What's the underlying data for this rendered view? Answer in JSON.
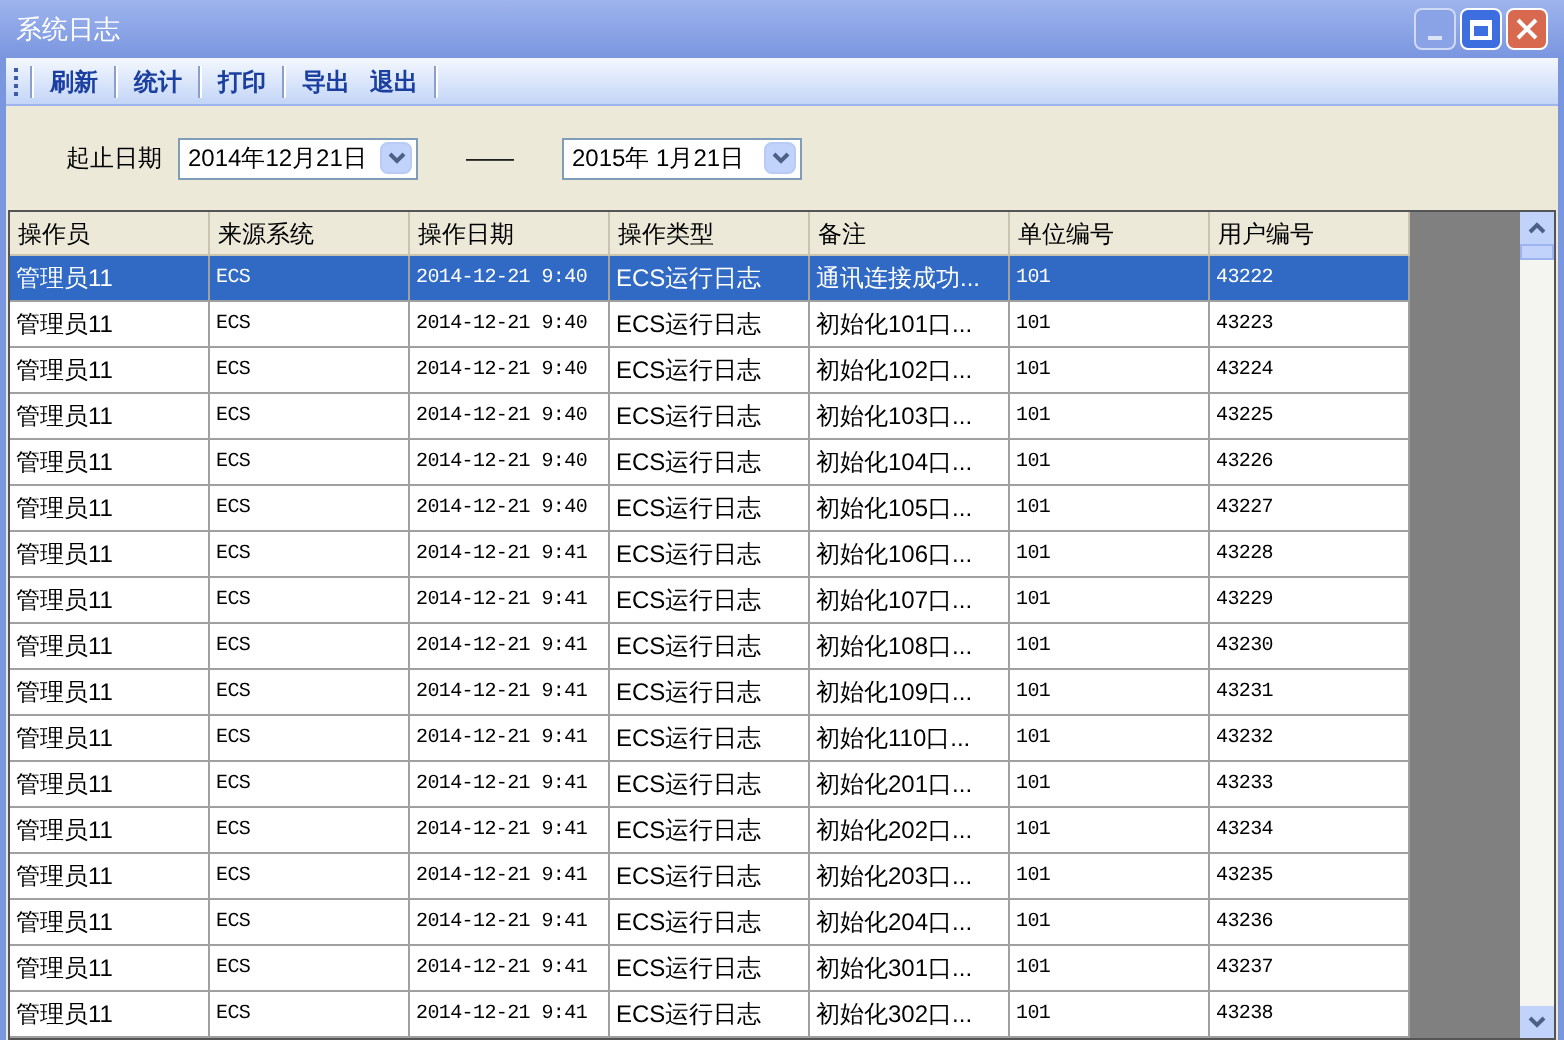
{
  "window": {
    "title": "系统日志"
  },
  "toolbar": [
    "刷新",
    "统计",
    "打印",
    "导出",
    "退出"
  ],
  "filter": {
    "label": "起止日期",
    "start": "2014年12月21日",
    "separator": "——",
    "end": "2015年 1月21日"
  },
  "table": {
    "columns": [
      "操作员",
      "来源系统",
      "操作日期",
      "操作类型",
      "备注",
      "单位编号",
      "用户编号"
    ],
    "rows": [
      {
        "selected": true,
        "cells": [
          "管理员11",
          "ECS",
          "2014-12-21 9:40",
          "ECS运行日志",
          "通讯连接成功...",
          "101",
          "43222"
        ]
      },
      {
        "selected": false,
        "cells": [
          "管理员11",
          "ECS",
          "2014-12-21 9:40",
          "ECS运行日志",
          "初始化101口...",
          "101",
          "43223"
        ]
      },
      {
        "selected": false,
        "cells": [
          "管理员11",
          "ECS",
          "2014-12-21 9:40",
          "ECS运行日志",
          "初始化102口...",
          "101",
          "43224"
        ]
      },
      {
        "selected": false,
        "cells": [
          "管理员11",
          "ECS",
          "2014-12-21 9:40",
          "ECS运行日志",
          "初始化103口...",
          "101",
          "43225"
        ]
      },
      {
        "selected": false,
        "cells": [
          "管理员11",
          "ECS",
          "2014-12-21 9:40",
          "ECS运行日志",
          "初始化104口...",
          "101",
          "43226"
        ]
      },
      {
        "selected": false,
        "cells": [
          "管理员11",
          "ECS",
          "2014-12-21 9:40",
          "ECS运行日志",
          "初始化105口...",
          "101",
          "43227"
        ]
      },
      {
        "selected": false,
        "cells": [
          "管理员11",
          "ECS",
          "2014-12-21 9:41",
          "ECS运行日志",
          "初始化106口...",
          "101",
          "43228"
        ]
      },
      {
        "selected": false,
        "cells": [
          "管理员11",
          "ECS",
          "2014-12-21 9:41",
          "ECS运行日志",
          "初始化107口...",
          "101",
          "43229"
        ]
      },
      {
        "selected": false,
        "cells": [
          "管理员11",
          "ECS",
          "2014-12-21 9:41",
          "ECS运行日志",
          "初始化108口...",
          "101",
          "43230"
        ]
      },
      {
        "selected": false,
        "cells": [
          "管理员11",
          "ECS",
          "2014-12-21 9:41",
          "ECS运行日志",
          "初始化109口...",
          "101",
          "43231"
        ]
      },
      {
        "selected": false,
        "cells": [
          "管理员11",
          "ECS",
          "2014-12-21 9:41",
          "ECS运行日志",
          "初始化110口...",
          "101",
          "43232"
        ]
      },
      {
        "selected": false,
        "cells": [
          "管理员11",
          "ECS",
          "2014-12-21 9:41",
          "ECS运行日志",
          "初始化201口...",
          "101",
          "43233"
        ]
      },
      {
        "selected": false,
        "cells": [
          "管理员11",
          "ECS",
          "2014-12-21 9:41",
          "ECS运行日志",
          "初始化202口...",
          "101",
          "43234"
        ]
      },
      {
        "selected": false,
        "cells": [
          "管理员11",
          "ECS",
          "2014-12-21 9:41",
          "ECS运行日志",
          "初始化203口...",
          "101",
          "43235"
        ]
      },
      {
        "selected": false,
        "cells": [
          "管理员11",
          "ECS",
          "2014-12-21 9:41",
          "ECS运行日志",
          "初始化204口...",
          "101",
          "43236"
        ]
      },
      {
        "selected": false,
        "cells": [
          "管理员11",
          "ECS",
          "2014-12-21 9:41",
          "ECS运行日志",
          "初始化301口...",
          "101",
          "43237"
        ]
      },
      {
        "selected": false,
        "cells": [
          "管理员11",
          "ECS",
          "2014-12-21 9:41",
          "ECS运行日志",
          "初始化302口...",
          "101",
          "43238"
        ]
      }
    ]
  }
}
